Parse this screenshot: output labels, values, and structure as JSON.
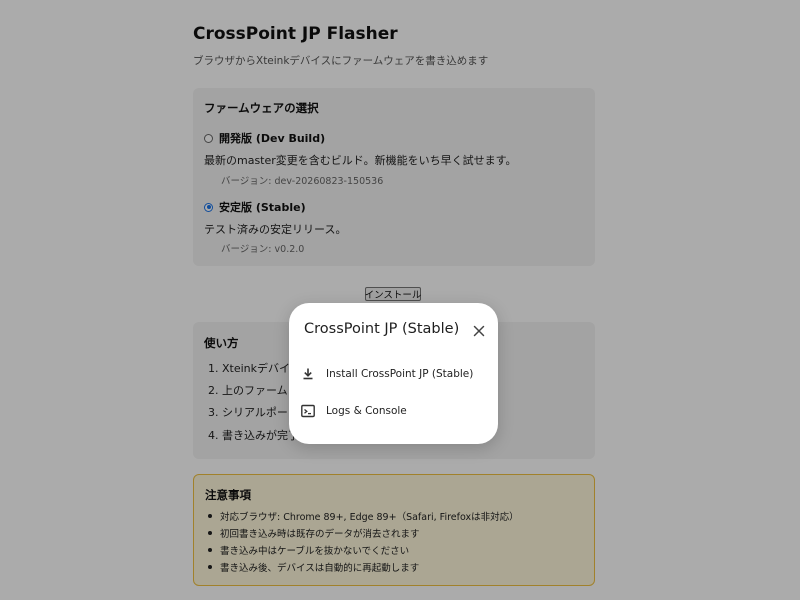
{
  "header": {
    "title": "CrossPoint JP Flasher",
    "subtitle": "ブラウザからXteinkデバイスにファームウェアを書き込めます"
  },
  "firmware": {
    "heading": "ファームウェアの選択",
    "options": [
      {
        "label": "開発版 (Dev Build)",
        "description": "最新のmaster変更を含むビルド。新機能をいち早く試せます。",
        "version": "バージョン: dev-20260823-150536",
        "selected": false
      },
      {
        "label": "安定版 (Stable)",
        "description": "テスト済みの安定リリース。",
        "version": "バージョン: v0.2.0",
        "selected": true
      }
    ]
  },
  "install_button": "インストール",
  "howto": {
    "heading": "使い方",
    "steps": [
      "1. Xteinkデバイス",
      "2. 上のファームウ",
      "3. シリアルポート",
      "4. 書き込みが完了"
    ]
  },
  "notes": {
    "heading": "注意事項",
    "items": [
      "対応ブラウザ: Chrome 89+, Edge 89+（Safari, Firefoxは非対応）",
      "初回書き込み時は既存のデータが消去されます",
      "書き込み中はケーブルを抜かないでください",
      "書き込み後、デバイスは自動的に再起動します"
    ]
  },
  "dialog": {
    "title": "CrossPoint JP (Stable)",
    "close_icon": "close-icon",
    "items": [
      {
        "label": "Install CrossPoint JP (Stable)",
        "icon": "download-icon"
      },
      {
        "label": "Logs & Console",
        "icon": "terminal-icon"
      }
    ]
  },
  "colors": {
    "accent": "#1a73e8",
    "overlay": "rgba(0,0,0,0.33)",
    "notes_bg": "#fff8dc",
    "notes_border": "#f0c040"
  }
}
